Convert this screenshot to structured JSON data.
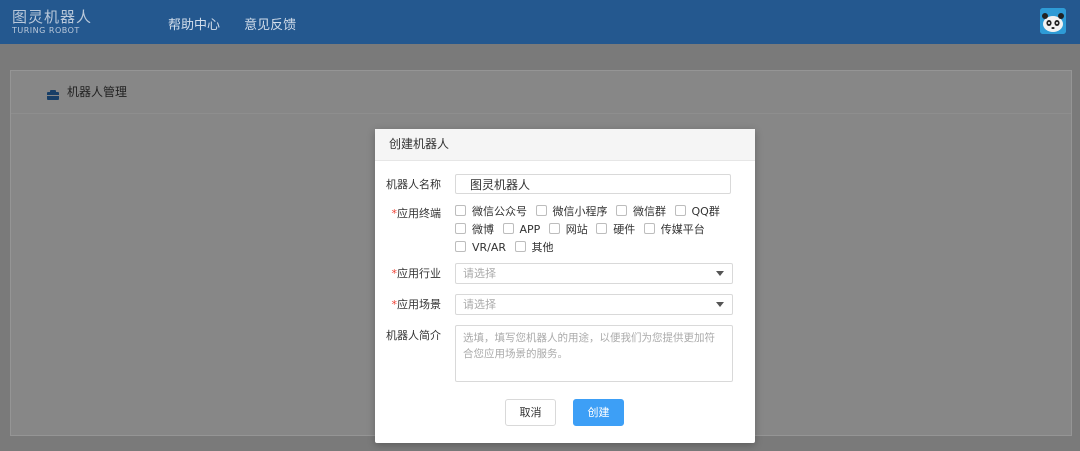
{
  "header": {
    "logo_main": "图灵机器人",
    "logo_sub": "TURING ROBOT",
    "nav": [
      "帮助中心",
      "意见反馈"
    ]
  },
  "page": {
    "section_title": "机器人管理"
  },
  "modal": {
    "title": "创建机器人",
    "name_label": "机器人名称",
    "name_value": "图灵机器人",
    "terminal_label": "应用终端",
    "terminals": [
      [
        "微信公众号",
        "微信小程序",
        "微信群",
        "QQ群"
      ],
      [
        "微博",
        "APP",
        "网站",
        "硬件",
        "传媒平台"
      ],
      [
        "VR/AR",
        "其他"
      ]
    ],
    "industry_label": "应用行业",
    "industry_placeholder": "请选择",
    "scene_label": "应用场景",
    "scene_placeholder": "请选择",
    "intro_label": "机器人简介",
    "intro_placeholder": "选填，填写您机器人的用途，以便我们为您提供更加符合您应用场景的服务。",
    "required_mark": "*",
    "cancel_label": "取消",
    "create_label": "创建"
  },
  "colors": {
    "topbar": "#24588f",
    "primary_button": "#3d9ff6",
    "required": "#f04134"
  }
}
